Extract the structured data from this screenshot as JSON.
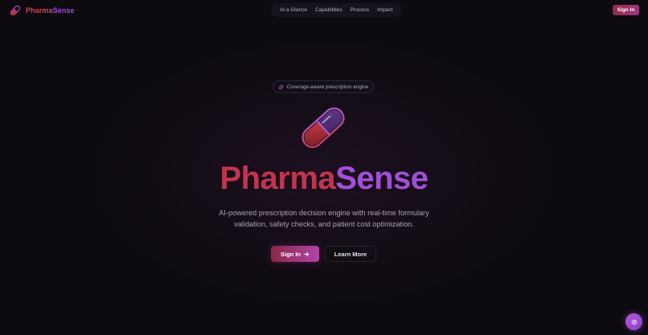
{
  "header": {
    "brand_part1": "Pharma",
    "brand_part2": "Sense",
    "nav": [
      "At a Glance",
      "Capabilities",
      "Process",
      "Impact"
    ],
    "signin_label": "Sign In"
  },
  "hero": {
    "badge_text": "Coverage-aware prescription engine",
    "title_part1": "Pharma",
    "title_part2": "Sense",
    "tagline_line1": "AI-powered prescription decision engine with real-time formulary",
    "tagline_line2": "validation, safety checks, and patient cost optimization.",
    "primary_button": "Sign In",
    "secondary_button": "Learn More"
  },
  "icons": {
    "logo": "pill-icon",
    "badge": "pill-icon",
    "primary_button": "arrow-right-icon",
    "fab": "settings-icon"
  },
  "colors": {
    "background": "#0d0b10",
    "brand_red": "#c2344e",
    "brand_purple": "#a14fd9",
    "accent_gradient_start": "#8c2747",
    "accent_gradient_end": "#b045a9"
  }
}
